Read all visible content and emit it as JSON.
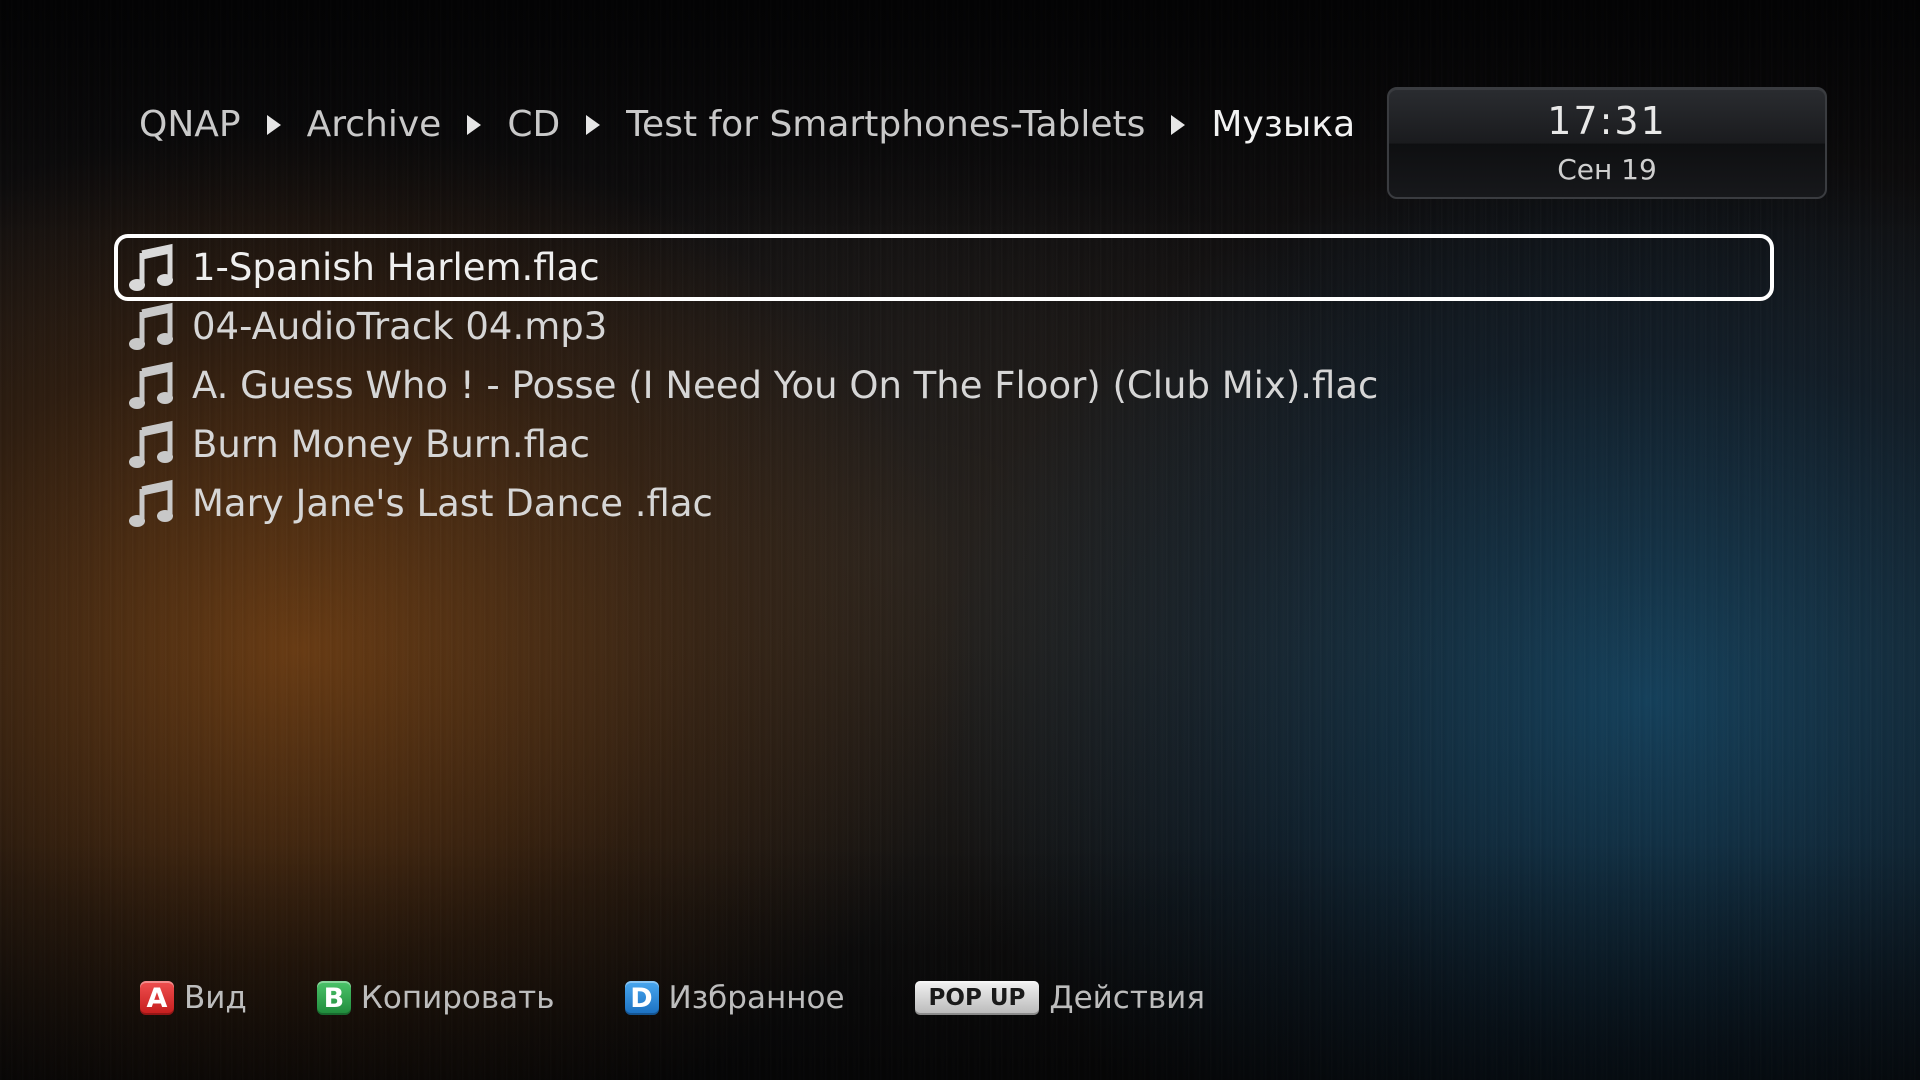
{
  "breadcrumb": {
    "items": [
      "QNAP",
      "Archive",
      "CD",
      "Test for Smartphones-Tablets"
    ],
    "current": "Музыка"
  },
  "clock": {
    "time": "17:31",
    "date": "Сен 19"
  },
  "files": [
    {
      "name": "1-Spanish Harlem.flac",
      "icon": "music-note-icon",
      "selected": true
    },
    {
      "name": "04-AudioTrack 04.mp3",
      "icon": "music-note-icon",
      "selected": false
    },
    {
      "name": "A. Guess Who ! - Posse (I Need You On The Floor) (Club Mix).flac",
      "icon": "music-note-icon",
      "selected": false
    },
    {
      "name": "Burn Money Burn.flac",
      "icon": "music-note-icon",
      "selected": false
    },
    {
      "name": "Mary Jane's Last Dance .flac",
      "icon": "music-note-icon",
      "selected": false
    }
  ],
  "hints": {
    "a": {
      "key": "A",
      "label": "Вид",
      "color": "#d42a2a"
    },
    "b": {
      "key": "B",
      "label": "Копировать",
      "color": "#2a9a47"
    },
    "d": {
      "key": "D",
      "label": "Избранное",
      "color": "#2a80d0"
    },
    "popup": {
      "key": "POP UP",
      "label": "Действия"
    }
  },
  "colors": {
    "selection_outline": "#ffffff",
    "text": "#d6d6d6"
  }
}
